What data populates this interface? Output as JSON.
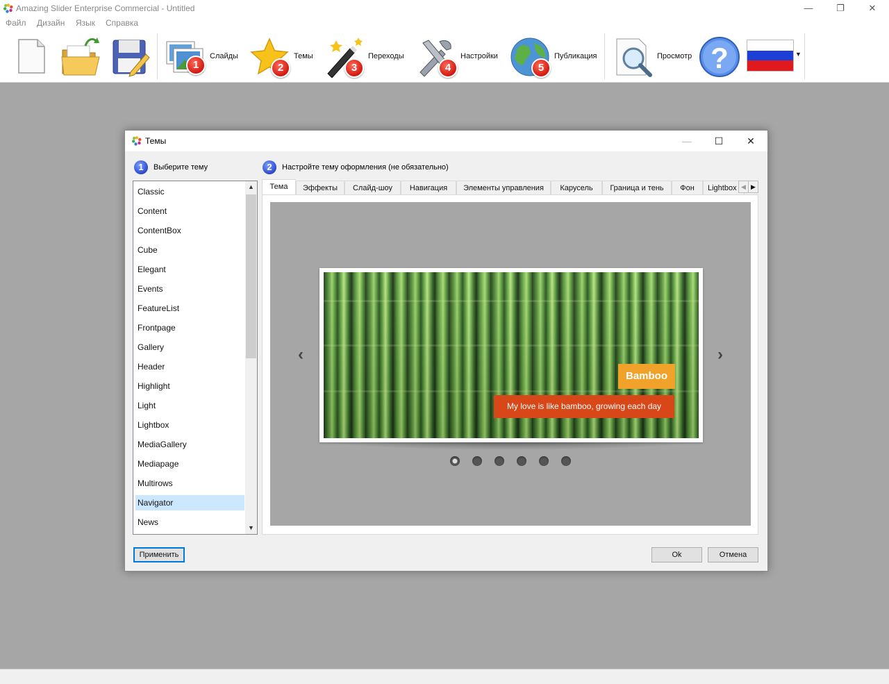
{
  "app": {
    "title": "Amazing Slider Enterprise Commercial - Untitled",
    "menu": [
      "Файл",
      "Дизайн",
      "Язык",
      "Справка"
    ]
  },
  "toolbar": {
    "slides_label": "Слайды",
    "themes_label": "Темы",
    "transitions_label": "Переходы",
    "settings_label": "Настройки",
    "publish_label": "Публикация",
    "preview_label": "Просмотр",
    "badges": [
      "1",
      "2",
      "3",
      "4",
      "5"
    ]
  },
  "dialog": {
    "title": "Темы",
    "step1_num": "1",
    "step1_label": "Выберите тему",
    "step2_num": "2",
    "step2_label": "Настройте тему оформления (не обязательно)",
    "themes": [
      "Classic",
      "Content",
      "ContentBox",
      "Cube",
      "Elegant",
      "Events",
      "FeatureList",
      "Frontpage",
      "Gallery",
      "Header",
      "Highlight",
      "Light",
      "Lightbox",
      "MediaGallery",
      "Mediapage",
      "Multirows",
      "Navigator",
      "News"
    ],
    "selected_theme": "Navigator",
    "tabs": [
      "Тема",
      "Эффекты",
      "Слайд-шоу",
      "Навигация",
      "Элементы управления",
      "Карусель",
      "Граница и тень",
      "Фон",
      "Lightbox"
    ],
    "active_tab": "Тема",
    "preview": {
      "caption_title": "Bamboo",
      "caption_text": "My love is like bamboo, growing each day",
      "bullet_count": 6,
      "active_bullet": 1
    },
    "apply_label": "Применить",
    "ok_label": "Ok",
    "cancel_label": "Отмена"
  }
}
